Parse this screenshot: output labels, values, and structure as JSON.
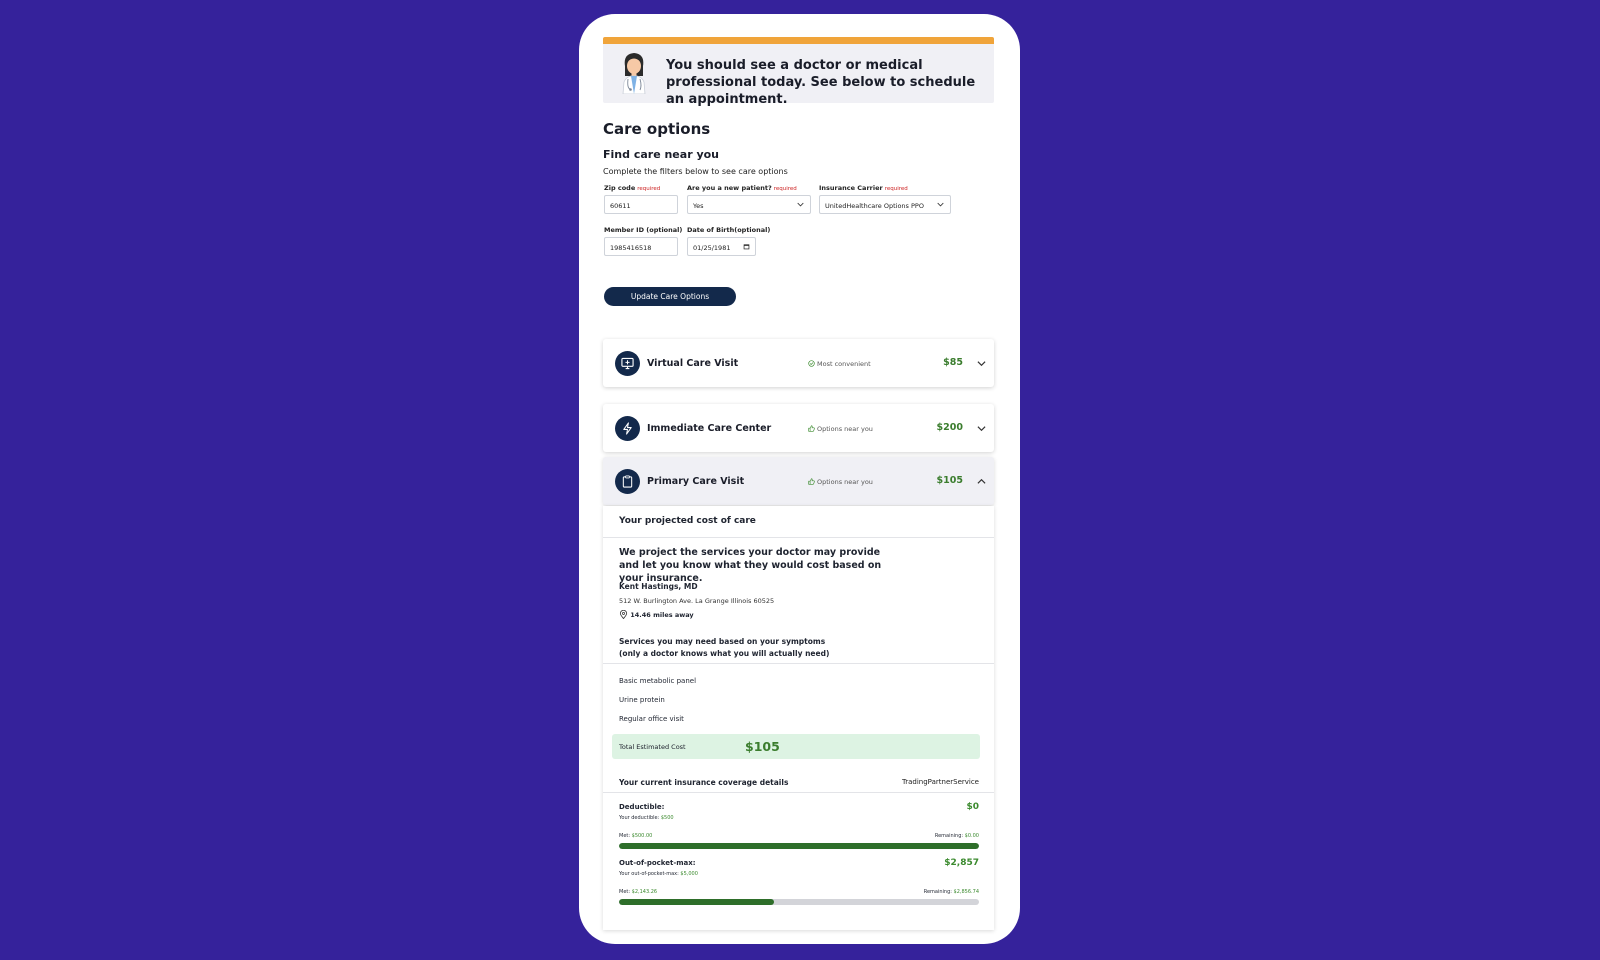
{
  "banner": {
    "message": "You should see a doctor or medical professional today. See below to schedule an appointment.",
    "accent_color": "#f0a43a",
    "avatar_icon": "doctor-avatar"
  },
  "care_options_title": "Care options",
  "find_care": {
    "title": "Find care near you",
    "subtitle": "Complete the filters below to see care options"
  },
  "filters": {
    "required_text": "required",
    "zip_label": "Zip code",
    "zip_value": "60611",
    "new_patient_label": "Are you a new patient?",
    "new_patient_value": "Yes",
    "carrier_label": "Insurance Carrier",
    "carrier_value": "UnitedHealthcare Options PPO",
    "member_label": "Member ID (optional)",
    "member_value": "1985416518",
    "dob_label": "Date of Birth(optional)",
    "dob_value": "01/25/1981",
    "update_button": "Update Care Options"
  },
  "cards": [
    {
      "title": "Virtual Care Visit",
      "tag": "Most convenient",
      "price": "$85",
      "icon": "monitor-icon",
      "expanded": false
    },
    {
      "title": "Immediate Care Center",
      "tag": "Options near you",
      "price": "$200",
      "icon": "lightning-icon",
      "expanded": false
    },
    {
      "title": "Primary Care Visit",
      "tag": "Options near you",
      "price": "$105",
      "icon": "clipboard-icon",
      "expanded": true
    }
  ],
  "detail": {
    "projected_title": "Your projected cost of care",
    "intro": "We project the services your doctor may provide and let you know what they would cost based on your insurance.",
    "doctor_name": "Kent Hastings, MD",
    "address": "512 W. Burlington Ave. La Grange Illinois 60525",
    "distance": "14.46 miles away",
    "services_heading_1": "Services you may need based on your symptoms",
    "services_heading_2": "(only a doctor knows what you will actually need)",
    "services": [
      "Basic metabolic panel",
      "Urine protein",
      "Regular office visit"
    ],
    "total_label": "Total Estimated Cost",
    "total_value": "$105",
    "coverage_title": "Your current insurance coverage details",
    "coverage_source": "TradingPartnerService",
    "deductible": {
      "label": "Deductible:",
      "amount": "$0",
      "your_label": "Your deductible:",
      "your_value": "$500",
      "met_label": "Met:",
      "met_value": "$500.00",
      "remaining_label": "Remaining:",
      "remaining_value": "$0.00",
      "progress": 1.0
    },
    "oop": {
      "label": "Out-of-pocket-max:",
      "amount": "$2,857",
      "your_label": "Your out-of-pocket-max:",
      "your_value": "$5,000",
      "met_label": "Met:",
      "met_value": "$2,143.26",
      "remaining_label": "Remaining:",
      "remaining_value": "$2,856.74",
      "progress": 0.43
    }
  },
  "colors": {
    "background": "#35229b",
    "navy": "#13294b",
    "price_green": "#3b7d2e",
    "progress_green": "#2e6e2a",
    "total_bg": "#ddf3e3"
  }
}
